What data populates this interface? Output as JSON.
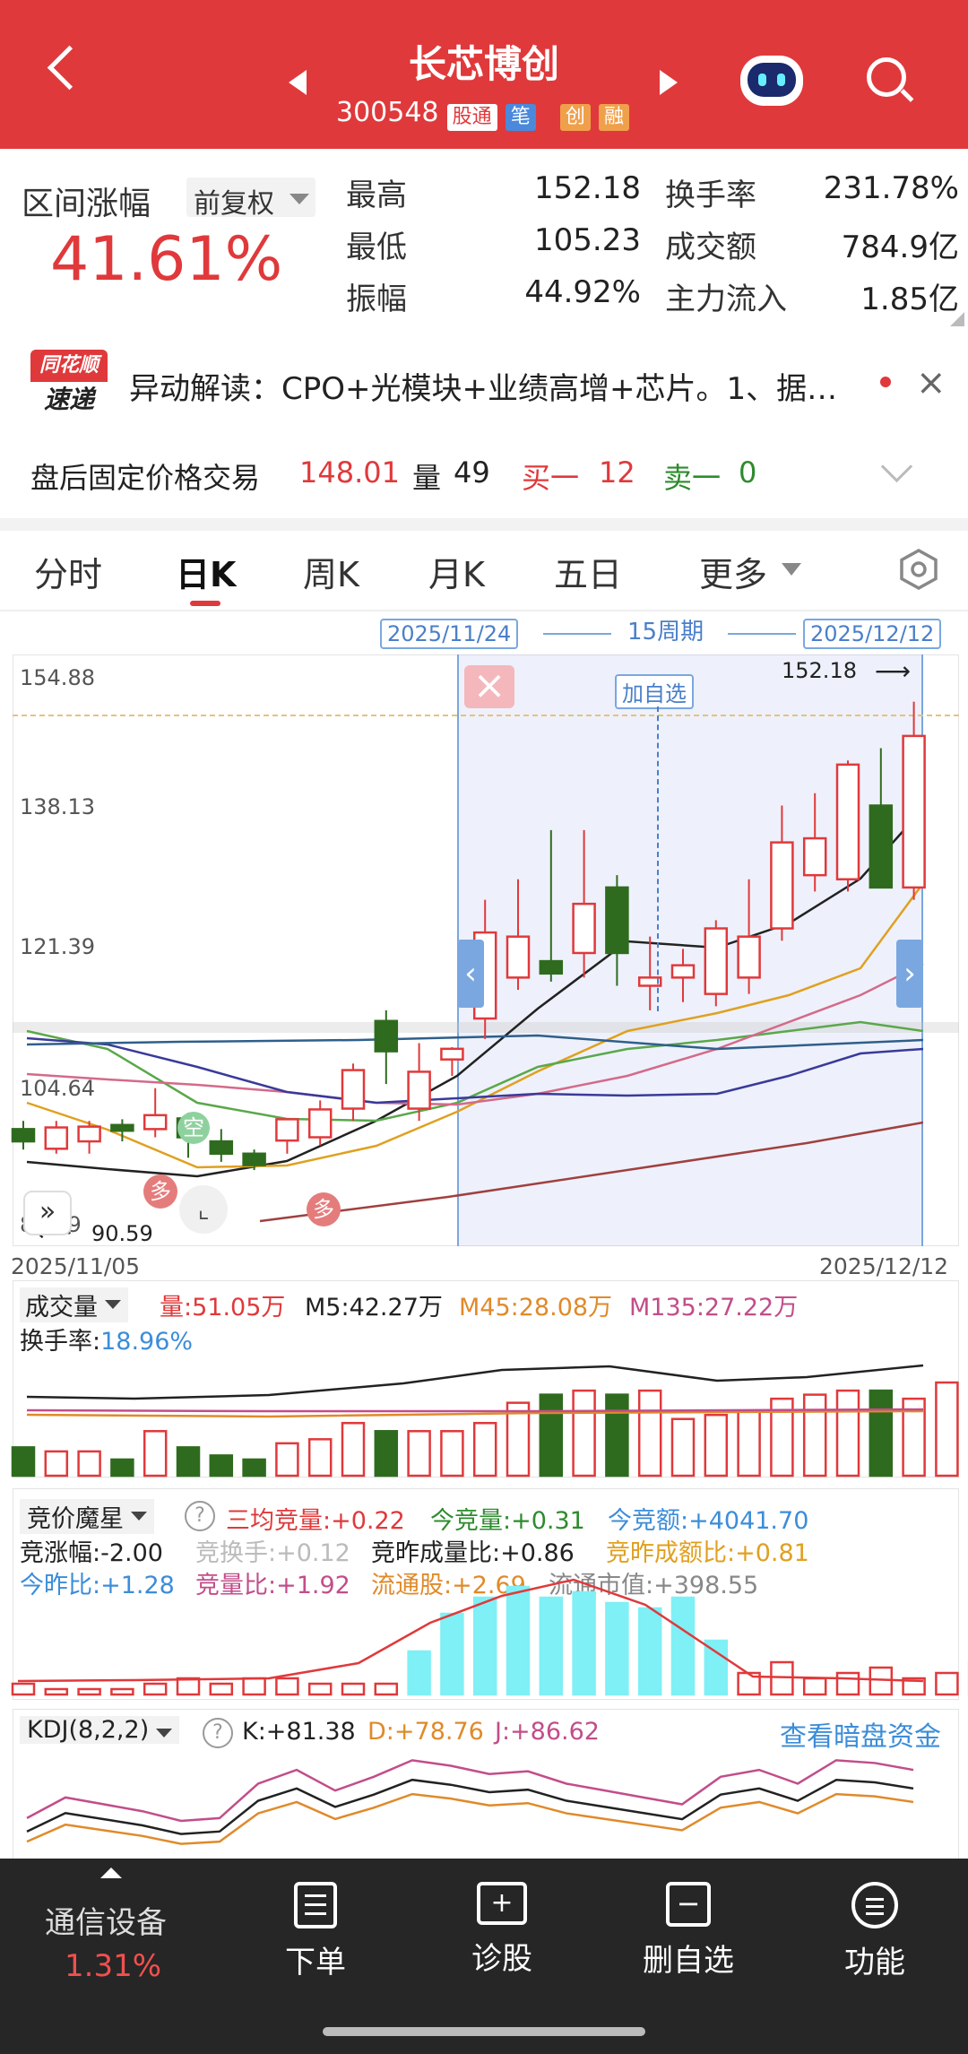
{
  "header": {
    "title": "长芯博创",
    "code": "300548",
    "tags": [
      "股通",
      "笔",
      "创",
      "融"
    ]
  },
  "stats": {
    "range_label": "区间涨幅",
    "adjust": "前复权",
    "range_value": "41.61%",
    "rows": [
      {
        "l1": "最高",
        "v1": "152.18",
        "l2": "换手率",
        "v2": "231.78%"
      },
      {
        "l1": "最低",
        "v1": "105.23",
        "l2": "成交额",
        "v2": "784.9亿"
      },
      {
        "l1": "振幅",
        "v1": "44.92%",
        "l2": "主力流入",
        "v2": "1.85亿"
      }
    ]
  },
  "news": {
    "logo_top": "同花顺",
    "logo_bottom": "速递",
    "text": "异动解读：CPO+光模块+业绩高增+芯片。1、据…"
  },
  "afterhours": {
    "label": "盘后固定价格交易",
    "price": "148.01",
    "vol_label": "量",
    "vol": "49",
    "buy_label": "买一",
    "buy": "12",
    "sell_label": "卖一",
    "sell": "0"
  },
  "tabs": [
    "分时",
    "日K",
    "周K",
    "月K",
    "五日",
    "更多"
  ],
  "chart": {
    "range_start": "2025/11/24",
    "range_period": "15周期",
    "range_end": "2025/12/12",
    "y_ticks": [
      "154.88",
      "138.13",
      "121.39",
      "104.64",
      "87.89"
    ],
    "high_label": "152.18",
    "low_label": "90.59",
    "add_watch": "加自选",
    "date_start": "2025/11/05",
    "date_end": "2025/12/12",
    "marks_kong": "空",
    "marks_duo": "多"
  },
  "chart_data": {
    "type": "candlestick",
    "ylim": [
      87.89,
      154.88
    ],
    "candles": [
      {
        "o": 100.0,
        "h": 101.0,
        "l": 97.5,
        "c": 98.5
      },
      {
        "o": 97.6,
        "h": 101.0,
        "l": 97.0,
        "c": 100.2
      },
      {
        "o": 98.5,
        "h": 101.0,
        "l": 97.0,
        "c": 100.3
      },
      {
        "o": 100.5,
        "h": 101.2,
        "l": 98.5,
        "c": 99.8
      },
      {
        "o": 100.0,
        "h": 105.0,
        "l": 99.0,
        "c": 101.7
      },
      {
        "o": 101.3,
        "h": 102.0,
        "l": 96.5,
        "c": 99.0
      },
      {
        "o": 98.5,
        "h": 100.0,
        "l": 96.0,
        "c": 97.0
      },
      {
        "o": 97.0,
        "h": 97.5,
        "l": 95.0,
        "c": 95.6
      },
      {
        "o": 98.6,
        "h": 101.0,
        "l": 97.0,
        "c": 101.2
      },
      {
        "o": 99.0,
        "h": 103.5,
        "l": 98.0,
        "c": 102.4
      },
      {
        "o": 102.5,
        "h": 108.0,
        "l": 101.0,
        "c": 107.2
      },
      {
        "o": 113.2,
        "h": 114.5,
        "l": 105.5,
        "c": 109.5
      },
      {
        "o": 102.5,
        "h": 110.5,
        "l": 101.0,
        "c": 107.0
      },
      {
        "o": 108.5,
        "h": 110.0,
        "l": 106.5,
        "c": 109.8
      },
      {
        "o": 113.5,
        "h": 128.0,
        "l": 111.0,
        "c": 124.0
      },
      {
        "o": 118.5,
        "h": 130.5,
        "l": 117.0,
        "c": 123.5
      },
      {
        "o": 120.5,
        "h": 136.5,
        "l": 118.0,
        "c": 119.0
      },
      {
        "o": 121.5,
        "h": 136.5,
        "l": 118.5,
        "c": 127.5
      },
      {
        "o": 129.5,
        "h": 131.0,
        "l": 117.5,
        "c": 121.5
      },
      {
        "o": 117.5,
        "h": 123.5,
        "l": 114.5,
        "c": 118.5
      },
      {
        "o": 118.5,
        "h": 122.0,
        "l": 115.5,
        "c": 120.0
      },
      {
        "o": 116.5,
        "h": 125.5,
        "l": 115.0,
        "c": 124.5
      },
      {
        "o": 118.5,
        "h": 130.5,
        "l": 116.5,
        "c": 123.5
      },
      {
        "o": 124.5,
        "h": 139.5,
        "l": 123.0,
        "c": 135.0
      },
      {
        "o": 131.0,
        "h": 141.0,
        "l": 129.0,
        "c": 135.5
      },
      {
        "o": 130.5,
        "h": 145.0,
        "l": 129.0,
        "c": 144.5
      },
      {
        "o": 139.5,
        "h": 146.5,
        "l": 130.5,
        "c": 129.5
      },
      {
        "o": 129.5,
        "h": 152.18,
        "l": 128.0,
        "c": 148.0
      }
    ],
    "volume": [
      7,
      6,
      6,
      4,
      11,
      7,
      5,
      4,
      8,
      9,
      13,
      11,
      11,
      11,
      13,
      18,
      20,
      21,
      20,
      21,
      14,
      15,
      16,
      19,
      20,
      21,
      21,
      19,
      23
    ],
    "auction": [
      2,
      1,
      1,
      1,
      2,
      3,
      2,
      3,
      3,
      2,
      2,
      2,
      8,
      15,
      18,
      20,
      18,
      19,
      17,
      16,
      18,
      10,
      4,
      6,
      3,
      4,
      5,
      3,
      4,
      6
    ],
    "kdj": [
      30,
      45,
      40,
      35,
      28,
      30,
      55,
      65,
      50,
      60,
      72,
      68,
      62,
      64,
      55,
      50,
      45,
      40,
      60,
      65,
      55,
      72,
      70,
      65
    ]
  },
  "volume_panel": {
    "title": "成交量",
    "vol": "量:51.05万",
    "m5": "M5:42.27万",
    "m45": "M45:28.08万",
    "m135": "M135:27.22万",
    "turnover": "换手率:",
    "turnover_val": "18.96%"
  },
  "auction_panel": {
    "title": "竞价魔星",
    "row1": [
      "三均竞量:+0.22",
      "今竞量:+0.31",
      "今竞额:+4041.70"
    ],
    "row2": [
      "竞涨幅:-2.00",
      "竞换手:+0.12",
      "竞昨成量比:+0.86",
      "竞昨成额比:+0.81"
    ],
    "row3": [
      "今昨比:+1.28",
      "竞量比:+1.92",
      "流通股:+2.69",
      "流通市值:+398.55"
    ]
  },
  "kdj_panel": {
    "title": "KDJ(8,2,2)",
    "k": "K:+81.38",
    "d": "D:+78.76",
    "j": "J:+86.62",
    "link": "查看暗盘资金"
  },
  "bottom": {
    "sector": "通信设备",
    "sector_change": "1.31%",
    "items": [
      "下单",
      "诊股",
      "删自选",
      "功能"
    ]
  },
  "colors": {
    "red": "#e0393b",
    "green": "#2f6b1f",
    "blue": "#3c8dd9"
  }
}
